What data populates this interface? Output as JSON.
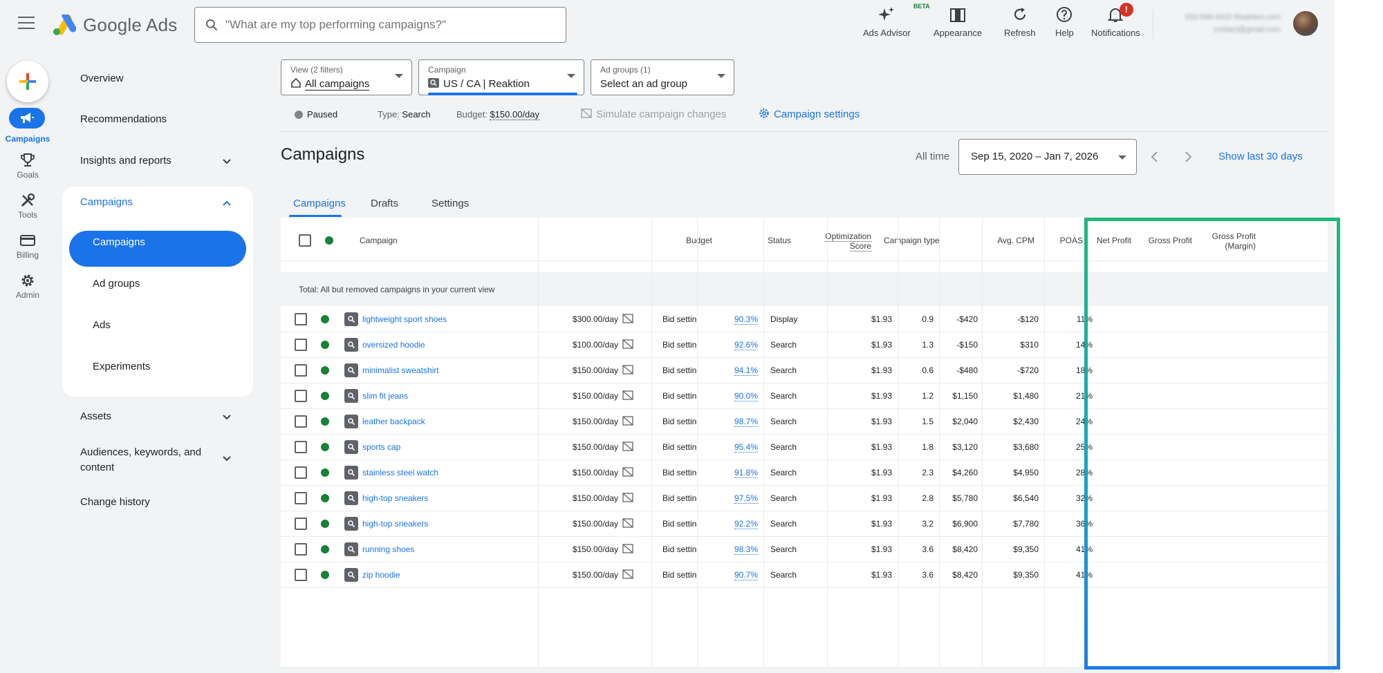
{
  "app": {
    "title": "Google Ads"
  },
  "search": {
    "placeholder": "\"What are my top performing campaigns?\""
  },
  "top_actions": [
    {
      "label": "Ads Advisor",
      "icon": "sparkle-icon",
      "badge": "BETA"
    },
    {
      "label": "Appearance",
      "icon": "appearance-icon"
    },
    {
      "label": "Refresh",
      "icon": "refresh-icon"
    },
    {
      "label": "Help",
      "icon": "help-icon"
    },
    {
      "label": "Notifications",
      "icon": "bell-icon",
      "badge": "!"
    }
  ],
  "account": {
    "line1": "533-998-0420 Reaktion.com",
    "line2": "contact@gmail.com"
  },
  "rail": [
    {
      "label": "Create",
      "icon": "create-plus-icon"
    },
    {
      "label": "Campaigns",
      "icon": "megaphone-icon",
      "active": true
    },
    {
      "label": "Goals",
      "icon": "trophy-icon"
    },
    {
      "label": "Tools",
      "icon": "tools-icon"
    },
    {
      "label": "Billing",
      "icon": "credit-card-icon"
    },
    {
      "label": "Admin",
      "icon": "gear-icon"
    }
  ],
  "nav": {
    "overview": "Overview",
    "recommendations": "Recommendations",
    "insights": "Insights and reports",
    "campaigns_group": "Campaigns",
    "sub": [
      "Campaigns",
      "Ad groups",
      "Ads",
      "Experiments"
    ],
    "assets": "Assets",
    "audiences": "Audiences, keywords, and content",
    "change_history": "Change history"
  },
  "selectors": {
    "view": {
      "caption": "View (2 filters)",
      "value": "All campaigns"
    },
    "campaign": {
      "caption": "Campaign",
      "value": "US / CA | Reaktion"
    },
    "ad_groups": {
      "caption": "Ad groups (1)",
      "value": "Select an ad group"
    }
  },
  "info": {
    "status": "Paused",
    "type_label": "Type:",
    "type_value": "Search",
    "budget_label": "Budget:",
    "budget_value": "$150.00/day",
    "simulate": "Simulate campaign changes",
    "settings": "Campaign settings"
  },
  "page": {
    "title": "Campaigns",
    "range_label": "All time",
    "date_range": "Sep 15, 2020 – Jan 7, 2026",
    "show_last": "Show last 30 days"
  },
  "tabs": [
    "Campaigns",
    "Drafts",
    "Settings"
  ],
  "table": {
    "headers": {
      "campaign": "Campaign",
      "budget": "Budget",
      "status": "Status",
      "opt1": "Optimization",
      "opt2": "Score",
      "type": "Campaign type",
      "cpm": "Avg. CPM",
      "poas": "POAS",
      "net": "Net Profit",
      "gross": "Gross Profit",
      "margin1": "Gross Profit",
      "margin2": "(Margin)"
    },
    "total_label": "Total: All but removed campaigns in your current view",
    "rows": [
      {
        "name": "lightweight sport shoes",
        "budget": "$300.00/day",
        "status": "Bid setting l",
        "opt": "90.3%",
        "type": "Display",
        "cpm": "$1.93",
        "poas": "0.9",
        "net": "-$420",
        "gross": "-$120",
        "margin": "11%"
      },
      {
        "name": "oversized hoodie",
        "budget": "$100.00/day",
        "status": "Bid setting l",
        "opt": "92.6%",
        "type": "Search",
        "cpm": "$1.93",
        "poas": "1.3",
        "net": "-$150",
        "gross": "$310",
        "margin": "14%"
      },
      {
        "name": "minimalist sweatshirt",
        "budget": "$150.00/day",
        "status": "Bid setting l",
        "opt": "94.1%",
        "type": "Search",
        "cpm": "$1.93",
        "poas": "0.6",
        "net": "-$480",
        "gross": "-$720",
        "margin": "18%"
      },
      {
        "name": "slim fit jeans",
        "budget": "$150.00/day",
        "status": "Bid setting l",
        "opt": "90.0%",
        "type": "Search",
        "cpm": "$1.93",
        "poas": "1.2",
        "net": "$1,150",
        "gross": "$1,480",
        "margin": "21%"
      },
      {
        "name": "leather backpack",
        "budget": "$150.00/day",
        "status": "Bid setting l",
        "opt": "98.7%",
        "type": "Search",
        "cpm": "$1.93",
        "poas": "1.5",
        "net": "$2,040",
        "gross": "$2,430",
        "margin": "24%"
      },
      {
        "name": "sports cap",
        "budget": "$150.00/day",
        "status": "Bid setting l",
        "opt": "95.4%",
        "type": "Search",
        "cpm": "$1.93",
        "poas": "1.8",
        "net": "$3,120",
        "gross": "$3,680",
        "margin": "25%"
      },
      {
        "name": "stainless steel watch",
        "budget": "$150.00/day",
        "status": "Bid setting l",
        "opt": "91.8%",
        "type": "Search",
        "cpm": "$1.93",
        "poas": "2.3",
        "net": "$4,260",
        "gross": "$4,950",
        "margin": "28%"
      },
      {
        "name": "high-top sneakers",
        "budget": "$150.00/day",
        "status": "Bid setting l",
        "opt": "97.5%",
        "type": "Search",
        "cpm": "$1.93",
        "poas": "2.8",
        "net": "$5,780",
        "gross": "$6,540",
        "margin": "32%"
      },
      {
        "name": "high-top sneakers",
        "budget": "$150.00/day",
        "status": "Bid setting l",
        "opt": "92.2%",
        "type": "Search",
        "cpm": "$1.93",
        "poas": "3.2",
        "net": "$6,900",
        "gross": "$7,780",
        "margin": "36%"
      },
      {
        "name": "running shoes",
        "budget": "$150.00/day",
        "status": "Bid setting l",
        "opt": "98.3%",
        "type": "Search",
        "cpm": "$1.93",
        "poas": "3.6",
        "net": "$8,420",
        "gross": "$9,350",
        "margin": "41%"
      },
      {
        "name": "zip hoodie",
        "budget": "$150.00/day",
        "status": "Bid setting l",
        "opt": "90.7%",
        "type": "Search",
        "cpm": "$1.93",
        "poas": "3.6",
        "net": "$8,420",
        "gross": "$9,350",
        "margin": "41%"
      }
    ]
  },
  "colors": {
    "accent": "#1a73e8",
    "status_green": "#188038",
    "highlight_start": "#1db97a",
    "highlight_end": "#1d7de8"
  }
}
